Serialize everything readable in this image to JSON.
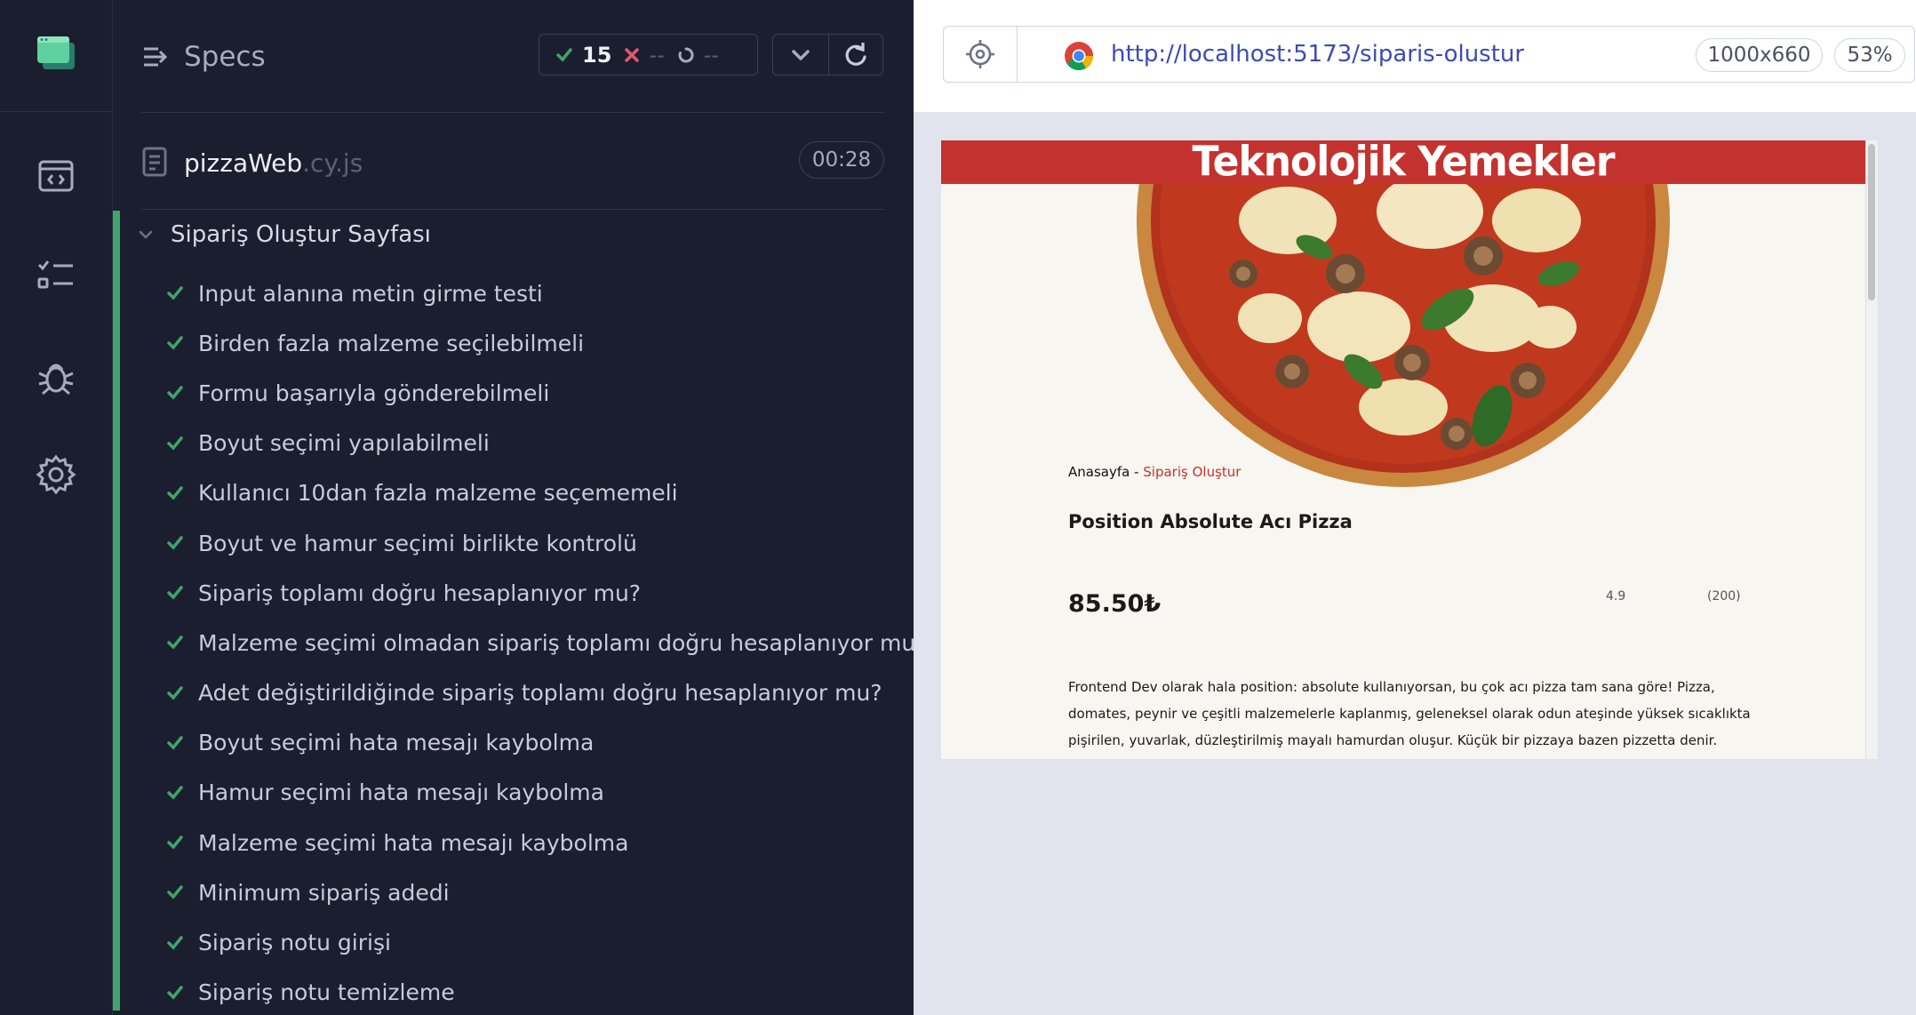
{
  "sidebar": {
    "items": [
      {
        "icon": "code-window-icon"
      },
      {
        "icon": "test-list-icon"
      },
      {
        "icon": "bug-icon"
      },
      {
        "icon": "gear-icon"
      }
    ]
  },
  "runner": {
    "title": "Specs",
    "stats": {
      "passed": "15",
      "failed": "--",
      "pending": "--"
    },
    "file": {
      "name": "pizzaWeb",
      "ext": ".cy.js",
      "duration": "00:28"
    },
    "suite": {
      "title": "Sipariş Oluştur Sayfası",
      "tests": [
        "Input alanına metin girme testi",
        "Birden fazla malzeme seçilebilmeli",
        "Formu başarıyla gönderebilmeli",
        "Boyut seçimi yapılabilmeli",
        "Kullanıcı 10dan fazla malzeme seçememeli",
        "Boyut ve hamur seçimi birlikte kontrolü",
        "Sipariş toplamı doğru hesaplanıyor mu?",
        "Malzeme seçimi olmadan sipariş toplamı doğru hesaplanıyor mu?",
        "Adet değiştirildiğinde sipariş toplamı doğru hesaplanıyor mu?",
        "Boyut seçimi hata mesajı kaybolma",
        "Hamur seçimi hata mesajı kaybolma",
        "Malzeme seçimi hata mesajı kaybolma",
        "Minimum sipariş adedi",
        "Sipariş notu girişi",
        "Sipariş notu temizleme"
      ]
    }
  },
  "browser": {
    "url": "http://localhost:5173/siparis-olustur",
    "viewport": "1000x660",
    "zoom": "53%"
  },
  "app": {
    "brand": "Teknolojik Yemekler",
    "breadcrumb": {
      "home": "Anasayfa",
      "separator": " - ",
      "current": "Sipariş Oluştur"
    },
    "product": {
      "title": "Position Absolute Acı Pizza",
      "price": "85.50₺",
      "rating": "4.9",
      "reviews": "(200)",
      "description": "Frontend Dev olarak hala position: absolute kullanıyorsan, bu çok acı pizza tam sana göre! Pizza, domates, peynir ve çeşitli malzemelerle kaplanmış, geleneksel olarak odun ateşinde yüksek sıcaklıkta pişirilen, yuvarlak, düzleştirilmiş mayalı hamurdan oluşur. Küçük bir pizzaya bazen pizzetta denir."
    }
  },
  "colors": {
    "pass": "#3fa569",
    "fail": "#e45770",
    "brand": "#c4322f",
    "url": "#3c4ab8"
  }
}
